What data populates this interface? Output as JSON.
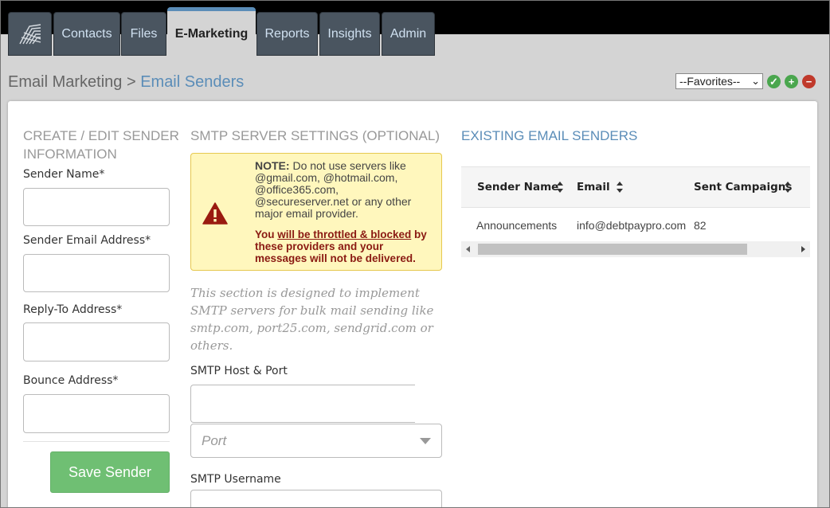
{
  "nav": {
    "tabs": [
      {
        "label": "Contacts"
      },
      {
        "label": "Files"
      },
      {
        "label": "E-Marketing"
      },
      {
        "label": "Reports"
      },
      {
        "label": "Insights"
      },
      {
        "label": "Admin"
      }
    ],
    "active_tab": "E-Marketing"
  },
  "breadcrumb": {
    "parent": "Email Marketing",
    "separator": " > ",
    "current": "Email Senders"
  },
  "favorites": {
    "selected": "--Favorites--"
  },
  "sender_form": {
    "title": "CREATE / EDIT SENDER INFORMATION",
    "sender_name_label": "Sender Name*",
    "sender_email_label": "Sender Email Address*",
    "reply_to_label": "Reply-To Address*",
    "bounce_label": "Bounce Address*",
    "save_label": "Save Sender"
  },
  "smtp": {
    "title": "SMTP SERVER SETTINGS (OPTIONAL)",
    "note_prefix": "NOTE:",
    "note_text": " Do not use servers like @gmail.com, @hotmail.com, @office365.com, @secureserver.net or any other major email provider.",
    "warning_pre": "You ",
    "warning_link": "will be throttled & blocked",
    "warning_post": " by these providers and your messages will not be delivered.",
    "description": "This section is designed to implement SMTP servers for bulk mail sending like smtp.com, port25.com, sendgrid.com or others.",
    "host_port_label": "SMTP Host & Port",
    "port_placeholder": "Port",
    "username_label": "SMTP Username"
  },
  "existing": {
    "title": "EXISTING EMAIL SENDERS",
    "columns": [
      "Sender Name",
      "Email",
      "Sent Campaigns"
    ],
    "rows": [
      {
        "sender_name": "Announcements",
        "email": "info@debtpaypro.com",
        "sent": "82"
      }
    ]
  },
  "colors": {
    "accent": "#5b8db8",
    "save_button": "#6fbf73",
    "note_bg": "#fff7bd",
    "warning_red": "#8a1a12"
  }
}
